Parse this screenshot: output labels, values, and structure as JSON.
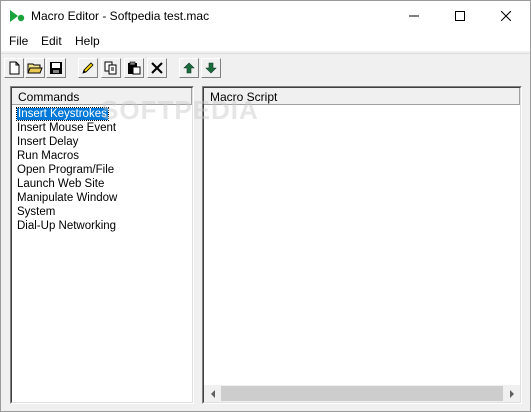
{
  "window": {
    "title": "Macro Editor - Softpedia test.mac"
  },
  "menu": {
    "items": [
      "File",
      "Edit",
      "Help"
    ]
  },
  "toolbar": {
    "buttons": [
      {
        "name": "new-file-icon"
      },
      {
        "name": "open-folder-icon"
      },
      {
        "name": "save-icon"
      },
      {
        "name": "edit-pencil-icon"
      },
      {
        "name": "copy-icon"
      },
      {
        "name": "paste-icon"
      },
      {
        "name": "delete-icon"
      },
      {
        "name": "move-up-icon"
      },
      {
        "name": "move-down-icon"
      }
    ]
  },
  "commands": {
    "header": "Commands",
    "items": [
      "Insert Keystrokes",
      "Insert Mouse Event",
      "Insert Delay",
      "Run Macros",
      "Open Program/File",
      "Launch Web Site",
      "Manipulate Window",
      "System",
      "Dial-Up Networking"
    ],
    "selected_index": 0
  },
  "script": {
    "header": "Macro Script"
  },
  "watermark": "SOFTPEDIA",
  "colors": {
    "selection": "#0078d7",
    "app_icon": "#1aa33b",
    "arrow_icon": "#1a6b3c"
  }
}
